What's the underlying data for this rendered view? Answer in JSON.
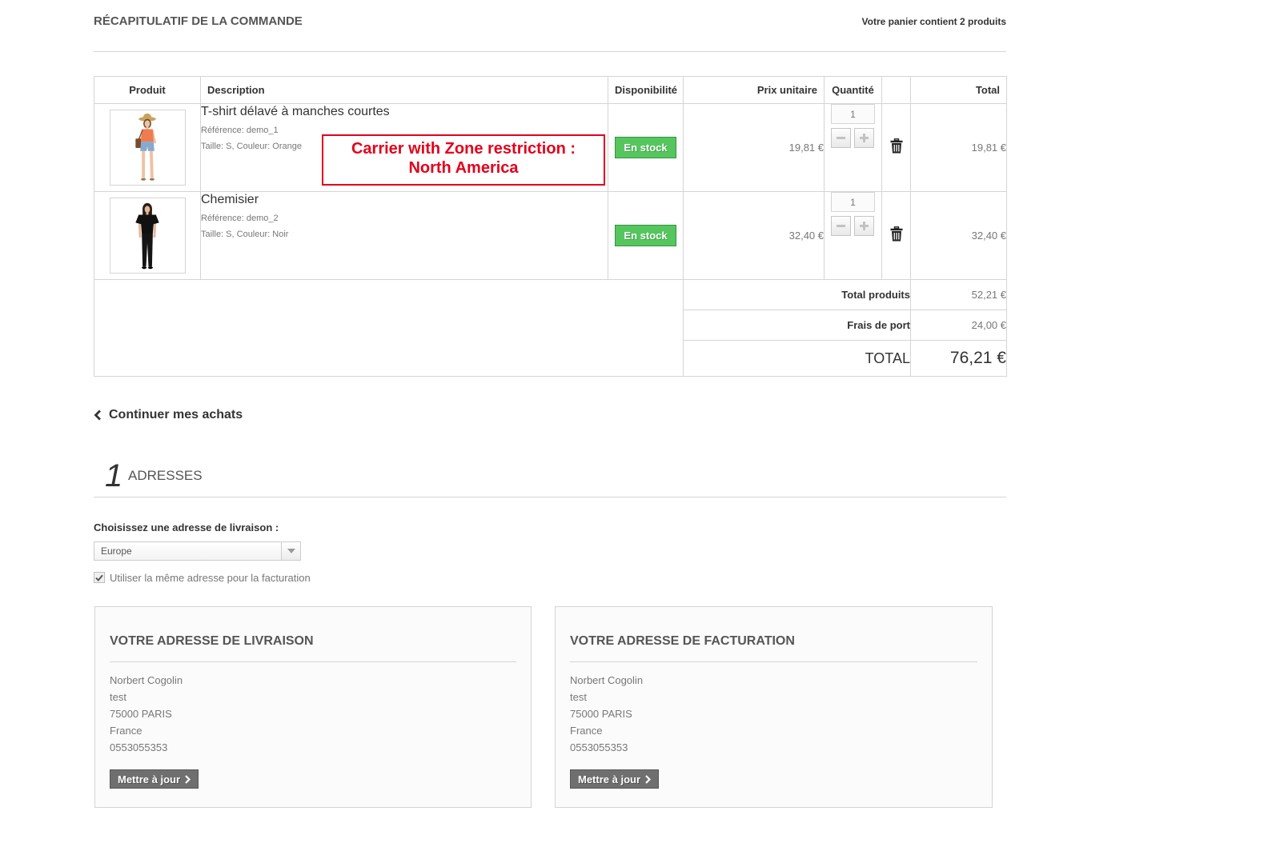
{
  "header": {
    "title": "RÉCAPITULATIF DE LA COMMANDE",
    "cart_count": "Votre panier contient 2 produits"
  },
  "cart": {
    "columns": {
      "product": "Produit",
      "description": "Description",
      "availability": "Disponibilité",
      "unit_price": "Prix unitaire",
      "quantity": "Quantité",
      "total": "Total"
    },
    "rows": [
      {
        "name": "T-shirt délavé à manches courtes",
        "reference": "Référence: demo_1",
        "attributes": "Taille: S, Couleur: Orange",
        "availability": "En stock",
        "unit_price": "19,81 €",
        "quantity": "1",
        "total": "19,81 €"
      },
      {
        "name": "Chemisier",
        "reference": "Référence: demo_2",
        "attributes": "Taille: S, Couleur: Noir",
        "availability": "En stock",
        "unit_price": "32,40 €",
        "quantity": "1",
        "total": "32,40 €"
      }
    ],
    "totals": {
      "products_label": "Total produits",
      "products_value": "52,21 €",
      "shipping_label": "Frais de port",
      "shipping_value": "24,00 €",
      "total_label": "TOTAL",
      "total_value": "76,21 €"
    }
  },
  "annotation": {
    "line1": "Carrier with Zone restriction :",
    "line2": "North America"
  },
  "continue_link": "Continuer mes achats",
  "step": {
    "number": "1",
    "title": "ADRESSES"
  },
  "address_form": {
    "label": "Choisissez une adresse de livraison :",
    "selected": "Europe",
    "same_address_label": "Utiliser la même adresse pour la facturation",
    "same_address_checked": true
  },
  "addresses": [
    {
      "title": "VOTRE ADRESSE DE LIVRAISON",
      "lines": [
        "Norbert Cogolin",
        "test",
        "75000 PARIS",
        "France",
        "0553055353"
      ],
      "button": "Mettre à jour"
    },
    {
      "title": "VOTRE ADRESSE DE FACTURATION",
      "lines": [
        "Norbert Cogolin",
        "test",
        "75000 PARIS",
        "France",
        "0553055353"
      ],
      "button": "Mettre à jour"
    }
  ],
  "icons": [
    "trash-icon",
    "minus-icon",
    "plus-icon",
    "chevron-left-icon",
    "chevron-right-icon",
    "dropdown-arrow-icon",
    "checkmark-icon"
  ],
  "colors": {
    "stock_badge": "#55c65e",
    "annotation": "#e3001b",
    "button": "#6f6f6f",
    "border": "#d6d4d4"
  }
}
